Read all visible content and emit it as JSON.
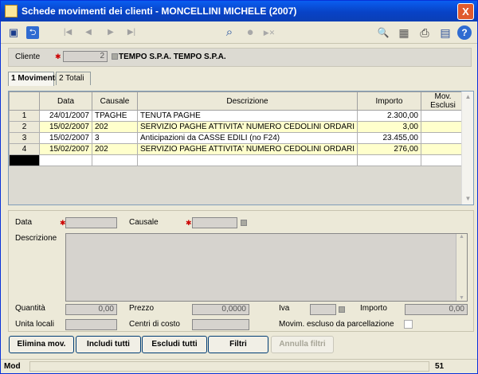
{
  "window": {
    "title": "Schede movimenti dei clienti  -  MONCELLINI MICHELE (2007)",
    "close_label": "X"
  },
  "toolbar": {
    "icons": [
      "save-icon",
      "back-icon",
      "first-icon",
      "prev-icon",
      "next-icon",
      "last-icon",
      "binoculars-icon",
      "record-icon",
      "skip-icon",
      "search-doc-icon",
      "calculator-icon",
      "print-icon",
      "preview-icon",
      "help-icon"
    ],
    "glyphs": {
      "save": "▣",
      "back": "⮌",
      "first": "|◀",
      "prev": "◀",
      "next": "▶",
      "last": "▶|",
      "find": "⌕",
      "record": "●",
      "skip": "▶✕",
      "searchdoc": "🔍",
      "calc": "▦",
      "print": "⎙",
      "preview": "▤",
      "help": "?"
    }
  },
  "client": {
    "label": "Cliente",
    "code": "2",
    "name": "TEMPO S.P.A. TEMPO S.P.A."
  },
  "tabs": [
    {
      "label": "1 Movimenti"
    },
    {
      "label": "2 Totali"
    }
  ],
  "grid": {
    "columns": [
      "",
      "Data",
      "Causale",
      "Descrizione",
      "Importo",
      "Mov. Esclusi"
    ],
    "rows": [
      {
        "n": "1",
        "data": "24/01/2007",
        "causale": "TPAGHE",
        "descrizione": "TENUTA PAGHE",
        "importo": "2.300,00",
        "esclusi": ""
      },
      {
        "n": "2",
        "data": "15/02/2007",
        "causale": "202",
        "descrizione": "SERVIZIO PAGHE ATTIVITA' NUMERO CEDOLINI ORDARI",
        "importo": "3,00",
        "esclusi": ""
      },
      {
        "n": "3",
        "data": "15/02/2007",
        "causale": "3",
        "descrizione": "Anticipazioni da CASSE EDILI (no F24)",
        "importo": "23.455,00",
        "esclusi": ""
      },
      {
        "n": "4",
        "data": "15/02/2007",
        "causale": "202",
        "descrizione": "SERVIZIO PAGHE ATTIVITA' NUMERO CEDOLINI ORDARI",
        "importo": "276,00",
        "esclusi": ""
      }
    ]
  },
  "detail": {
    "data_label": "Data",
    "causale_label": "Causale",
    "descrizione_label": "Descrizione",
    "quantita_label": "Quantità",
    "quantita_value": "0,00",
    "prezzo_label": "Prezzo",
    "prezzo_value": "0,0000",
    "iva_label": "Iva",
    "importo_label": "Importo",
    "importo_value": "0,00",
    "unita_label": "Unita locali",
    "centri_label": "Centri di costo",
    "movim_label": "Movim. escluso da parcellazione"
  },
  "buttons": {
    "elimina": "Elimina mov.",
    "includi": "Includi tutti",
    "escludi": "Escludi tutti",
    "filtri": "Filtri",
    "annulla": "Annulla filtri"
  },
  "status": {
    "mode": "Mod",
    "number": "51"
  }
}
